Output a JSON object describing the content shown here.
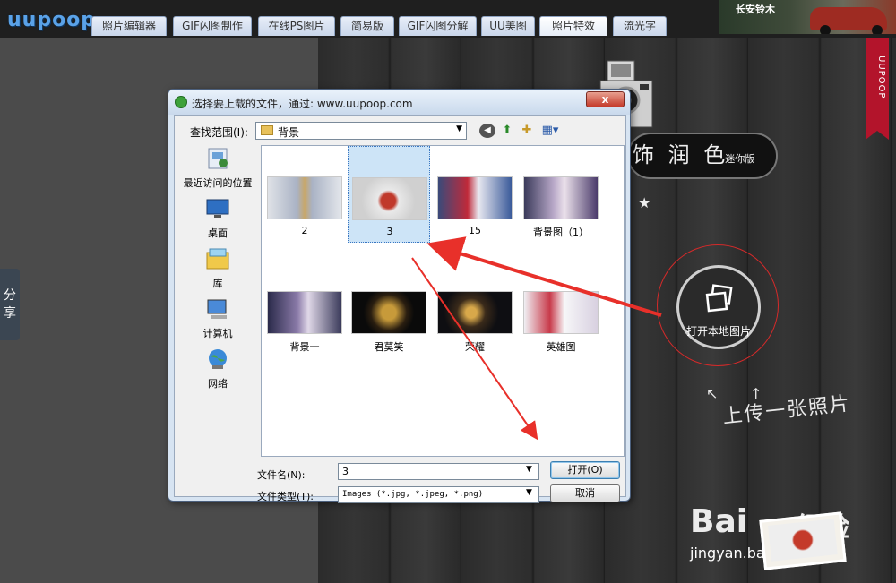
{
  "header": {
    "logo": "uupoop",
    "tabs": [
      {
        "label": "照片编辑器"
      },
      {
        "label": "GIF闪图制作"
      },
      {
        "label": "在线PS图片"
      },
      {
        "label": "简易版"
      },
      {
        "label": "GIF闪图分解"
      },
      {
        "label": "UU美图"
      },
      {
        "label": "照片特效",
        "active": true
      },
      {
        "label": "流光字"
      }
    ],
    "ad_text": "长安铃木"
  },
  "sidebar": {
    "share_label": "分享"
  },
  "ribbon": {
    "text": "UUPOOP"
  },
  "hero": {
    "title": "饰 润 色",
    "title_small": "迷你版",
    "open_button_label": "打开本地图片",
    "upload_caption": "上传一张照片"
  },
  "dialog": {
    "title": "选择要上载的文件，通过: www.uupoop.com",
    "close_label": "x",
    "look_in_label": "查找范围(I):",
    "look_in_value": "背景",
    "places": [
      {
        "label": "最近访问的位置",
        "icon": "recent-places-icon"
      },
      {
        "label": "桌面",
        "icon": "desktop-icon"
      },
      {
        "label": "库",
        "icon": "libraries-icon"
      },
      {
        "label": "计算机",
        "icon": "computer-icon"
      },
      {
        "label": "网络",
        "icon": "network-icon"
      }
    ],
    "files": [
      {
        "name": "2"
      },
      {
        "name": "3",
        "selected": true
      },
      {
        "name": "15"
      },
      {
        "name": "背景图（1）"
      },
      {
        "name": "背景一"
      },
      {
        "name": "君莫笑"
      },
      {
        "name": "荣耀"
      },
      {
        "name": "英雄图"
      }
    ],
    "file_name_label": "文件名(N):",
    "file_name_value": "3",
    "file_type_label": "文件类型(T):",
    "file_type_value": "Images (*.jpg, *.jpeg, *.png)",
    "open_button": "打开(O)",
    "cancel_button": "取消"
  },
  "watermark": {
    "brand": "Bai",
    "brand_cn": "经验",
    "url": "jingyan.baidu.com"
  },
  "colors": {
    "annotation_red": "#e8302a",
    "dialog_frame": "#d7e4f2",
    "selection": "#cde4f7",
    "ribbon": "#b3142b",
    "logo_blue": "#5aa2e8"
  }
}
